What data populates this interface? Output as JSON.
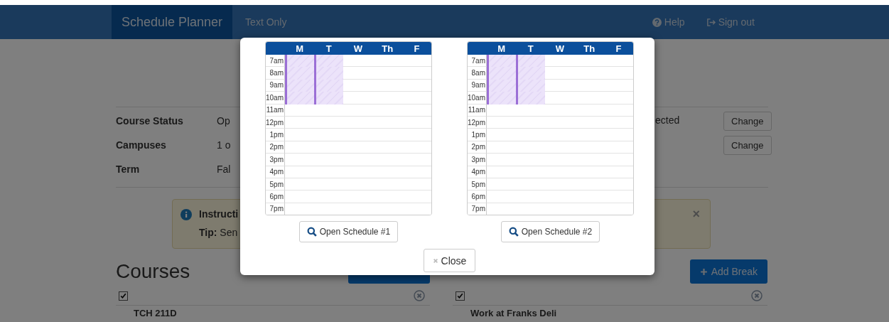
{
  "navbar": {
    "brand": "Schedule Planner",
    "links": [
      {
        "label": "Text Only",
        "kind": "plain"
      },
      {
        "label": "Help",
        "kind": "help"
      },
      {
        "label": "Sign out",
        "kind": "sign_out"
      }
    ]
  },
  "settings": [
    {
      "label": "Course Status",
      "value": "Op",
      "note": "ected",
      "button": "Change"
    },
    {
      "label": "Campuses",
      "value": "1 o",
      "button": "Change"
    },
    {
      "label": "Term",
      "value": "Fal"
    }
  ],
  "alert": {
    "title": "Instructi",
    "tip": "**Tip:** Sen",
    "dismiss": "×"
  },
  "courses": {
    "heading": "Courses",
    "select_all": {
      "checked": true
    },
    "items": [
      {
        "name": "TCH 211D"
      }
    ]
  },
  "breaks": {
    "button": "Add Break",
    "select_all": {
      "checked": true
    },
    "items": [
      {
        "name": "Work at Franks Deli"
      }
    ]
  },
  "modal": {
    "close": "Close",
    "schedules": [
      {
        "days": [
          "M",
          "T",
          "W",
          "Th",
          "F"
        ],
        "button": "Open Schedule #1",
        "rows": [
          {
            "time": "7am",
            "booked": [
              true,
              true,
              false,
              false,
              false
            ]
          },
          {
            "time": "8am",
            "booked": [
              true,
              true,
              false,
              false,
              false
            ]
          },
          {
            "time": "9am",
            "booked": [
              true,
              true,
              false,
              false,
              false
            ]
          },
          {
            "time": "10am",
            "booked": [
              true,
              true,
              false,
              false,
              false
            ]
          },
          {
            "time": "11am",
            "booked": [
              false,
              false,
              false,
              false,
              false
            ]
          },
          {
            "time": "12pm",
            "booked": [
              false,
              false,
              false,
              false,
              false
            ]
          },
          {
            "time": "1pm",
            "booked": [
              false,
              false,
              false,
              false,
              false
            ]
          },
          {
            "time": "2pm",
            "booked": [
              false,
              false,
              false,
              false,
              false
            ]
          },
          {
            "time": "3pm",
            "booked": [
              false,
              false,
              false,
              false,
              false
            ]
          },
          {
            "time": "4pm",
            "booked": [
              false,
              false,
              false,
              false,
              false
            ]
          },
          {
            "time": "5pm",
            "booked": [
              false,
              false,
              false,
              false,
              false
            ]
          },
          {
            "time": "6pm",
            "booked": [
              false,
              false,
              false,
              false,
              false
            ]
          },
          {
            "time": "7pm",
            "booked": [
              false,
              false,
              false,
              false,
              false
            ]
          }
        ]
      },
      {
        "days": [
          "M",
          "T",
          "W",
          "Th",
          "F"
        ],
        "button": "Open Schedule #2",
        "rows": [
          {
            "time": "7am",
            "booked": [
              true,
              true,
              false,
              false,
              false
            ]
          },
          {
            "time": "8am",
            "booked": [
              true,
              true,
              false,
              false,
              false
            ]
          },
          {
            "time": "9am",
            "booked": [
              true,
              true,
              false,
              false,
              false
            ]
          },
          {
            "time": "10am",
            "booked": [
              true,
              true,
              false,
              false,
              false
            ]
          },
          {
            "time": "11am",
            "booked": [
              false,
              false,
              false,
              false,
              false
            ]
          },
          {
            "time": "12pm",
            "booked": [
              false,
              false,
              false,
              false,
              false
            ]
          },
          {
            "time": "1pm",
            "booked": [
              false,
              false,
              false,
              false,
              false
            ]
          },
          {
            "time": "2pm",
            "booked": [
              false,
              false,
              false,
              false,
              false
            ]
          },
          {
            "time": "3pm",
            "booked": [
              false,
              false,
              false,
              false,
              false
            ]
          },
          {
            "time": "4pm",
            "booked": [
              false,
              false,
              false,
              false,
              false
            ]
          },
          {
            "time": "5pm",
            "booked": [
              false,
              false,
              false,
              false,
              false
            ]
          },
          {
            "time": "6pm",
            "booked": [
              false,
              false,
              false,
              false,
              false
            ]
          },
          {
            "time": "7pm",
            "booked": [
              false,
              false,
              false,
              false,
              false
            ]
          }
        ]
      }
    ]
  }
}
